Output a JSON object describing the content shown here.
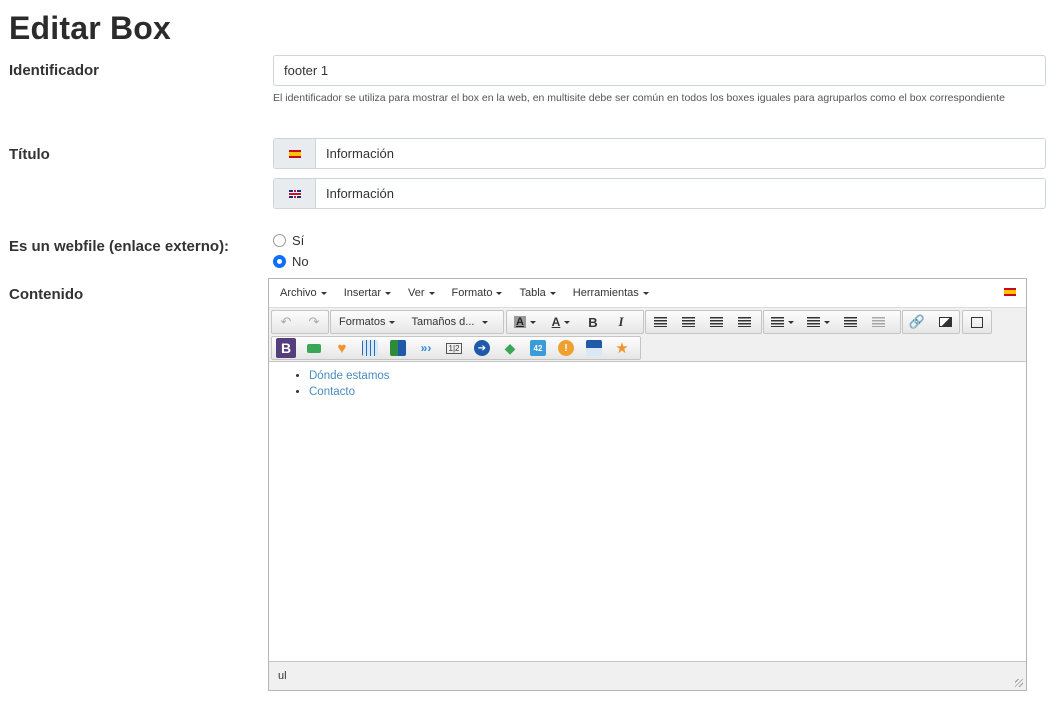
{
  "page": {
    "title": "Editar Box"
  },
  "identifier": {
    "label": "Identificador",
    "value": "footer 1",
    "help": "El identificador se utiliza para mostrar el box en la web, en multisite debe ser común en todos los boxes iguales para agruparlos como el box correspondiente"
  },
  "title_field": {
    "label": "Título",
    "langs": [
      {
        "flag": "flag-es-icon",
        "value": "Información"
      },
      {
        "flag": "flag-en-icon",
        "value": "Información"
      }
    ]
  },
  "webfile": {
    "label": "Es un webfile (enlace externo):",
    "options": [
      {
        "label": "Sí",
        "checked": false
      },
      {
        "label": "No",
        "checked": true
      }
    ],
    "accent": "#0d6efd"
  },
  "content": {
    "label": "Contenido",
    "menubar": [
      "Archivo",
      "Insertar",
      "Ver",
      "Formato",
      "Tabla",
      "Herramientas"
    ],
    "formats_label": "Formatos",
    "sizes_label": "Tamaños d...",
    "items": [
      "Dónde estamos",
      "Contacto"
    ],
    "status_path": "ul",
    "link_color": "#4a8bc2"
  }
}
